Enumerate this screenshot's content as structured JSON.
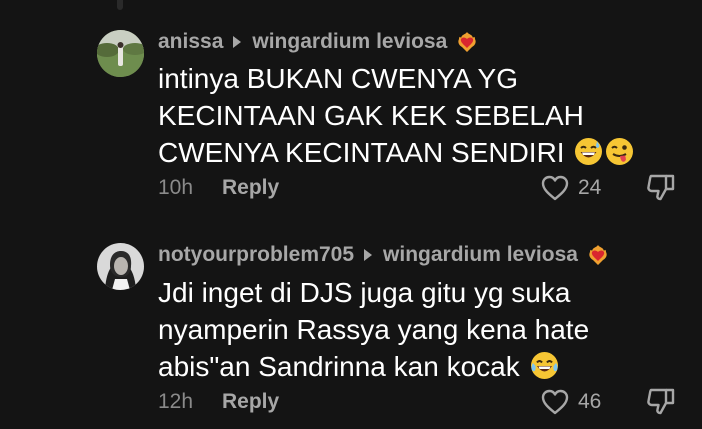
{
  "comments": [
    {
      "username": "anissa",
      "reply_to": "wingardium leviosa",
      "lines": [
        "intinya BUKAN CWENYA YG",
        "KECINTAAN GAK KEK SEBELAH",
        "CWENYA KECINTAAN SENDIRI"
      ],
      "emojis": [
        "grinning-sweat-emoji",
        "winking-tongue-emoji"
      ],
      "timestamp": "10h",
      "reply_label": "Reply",
      "likes": "24"
    },
    {
      "username": "notyourproblem705",
      "reply_to": "wingardium leviosa",
      "lines": [
        "Jdi inget di DJS juga gitu yg suka",
        "nyamperin Rassya yang kena hate",
        "abis\"an Sandrinna kan kocak"
      ],
      "emojis": [
        "tears-of-joy-emoji"
      ],
      "timestamp": "12h",
      "reply_label": "Reply",
      "likes": "46"
    }
  ],
  "colors": {
    "background": "#141414",
    "primary_text": "#ffffff",
    "secondary_text": "#a7a7a7",
    "timestamp_text": "#8a8a8a"
  }
}
